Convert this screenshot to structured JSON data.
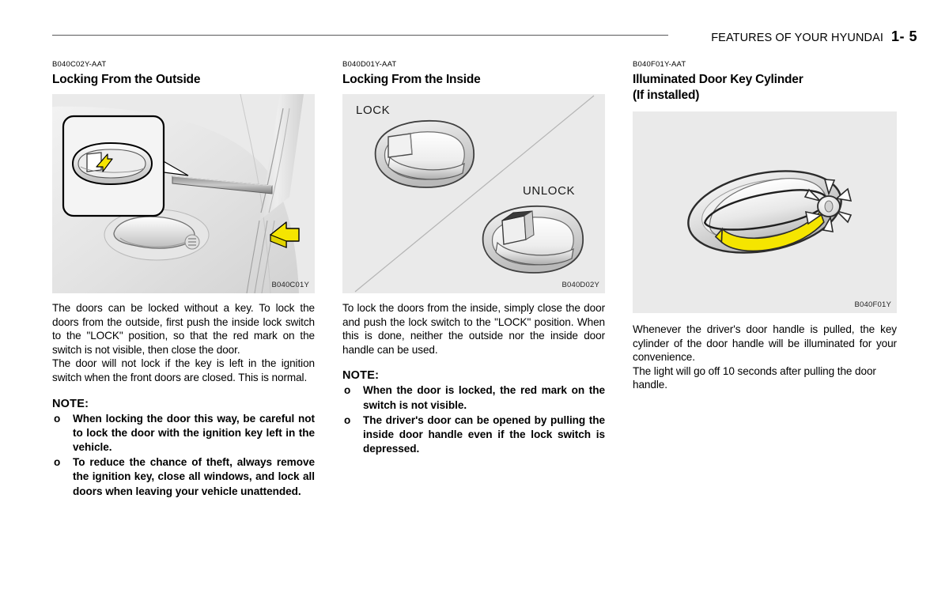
{
  "header": {
    "title": "FEATURES OF YOUR HYUNDAI",
    "page_number": "1- 5"
  },
  "columns": [
    {
      "code": "B040C02Y-AAT",
      "title": "Locking From the Outside",
      "figure": {
        "code": "B040C01Y",
        "alt": "Car door shown from outside with inset close-up of interior door handle and lock switch; yellow arrows indicate pushing the lock switch and closing the door."
      },
      "paragraphs": [
        "The doors can be locked without a key. To lock the doors from the outside, first push the inside lock switch to the \"LOCK\" position, so that the red mark on the switch is not visible, then close the door.",
        "The door will not lock if the key is left in the ignition switch when the front doors are closed. This is normal."
      ],
      "note_heading": "NOTE:",
      "notes": [
        "When locking the door this way, be careful not to lock the door with the ignition key left in the vehicle.",
        "To reduce the chance of theft, always remove the ignition key, close all windows, and lock all doors when leaving your vehicle unattended."
      ],
      "bullet": "o"
    },
    {
      "code": "B040D01Y-AAT",
      "title": "Locking From the Inside",
      "figure": {
        "code": "B040D02Y",
        "label_lock": "LOCK",
        "label_unlock": "UNLOCK",
        "alt": "Two inside door handles: upper one with lock switch depressed (LOCK), lower one with lock switch raised (UNLOCK), separated by a diagonal line."
      },
      "paragraphs": [
        "To lock the doors from the inside, simply close the door and push the lock switch to the \"LOCK\" position.  When this is done, neither the outside nor the inside door handle can be used."
      ],
      "note_heading": "NOTE:",
      "notes": [
        "When the door is locked, the red mark on the switch is not visible.",
        "The driver's door can be opened by pulling the inside door handle even if the lock switch is depressed."
      ],
      "bullet": "o"
    },
    {
      "code": "B040F01Y-AAT",
      "title": "Illuminated Door Key Cylinder",
      "title_line2": "(If installed)",
      "figure": {
        "code": "B040F01Y",
        "alt": "Outside door handle being pulled, shown with a yellow arrow, and the key cylinder emitting light rays."
      },
      "paragraphs": [
        "Whenever the driver's door handle is pulled, the key cylinder of the door handle will be illuminated for your convenience.",
        "The light will go off 10 seconds after pulling the door handle."
      ]
    }
  ],
  "colors": {
    "page_background": "#ffffff",
    "figure_background": "#eaeaea",
    "rule": "#59595b",
    "highlight_yellow": "#f5e500",
    "text": "#000000"
  }
}
